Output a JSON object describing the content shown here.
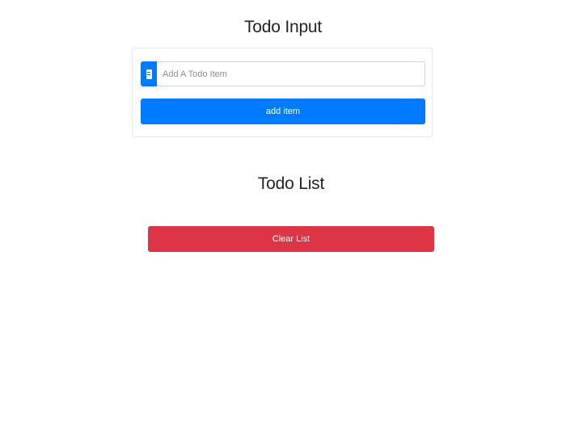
{
  "input_section": {
    "title": "Todo Input",
    "input_placeholder": "Add A Todo Item",
    "input_icon": "book-icon",
    "add_label": "add item"
  },
  "list_section": {
    "title": "Todo List",
    "clear_label": "Clear List"
  },
  "colors": {
    "primary": "#007bff",
    "danger": "#dc3545"
  }
}
